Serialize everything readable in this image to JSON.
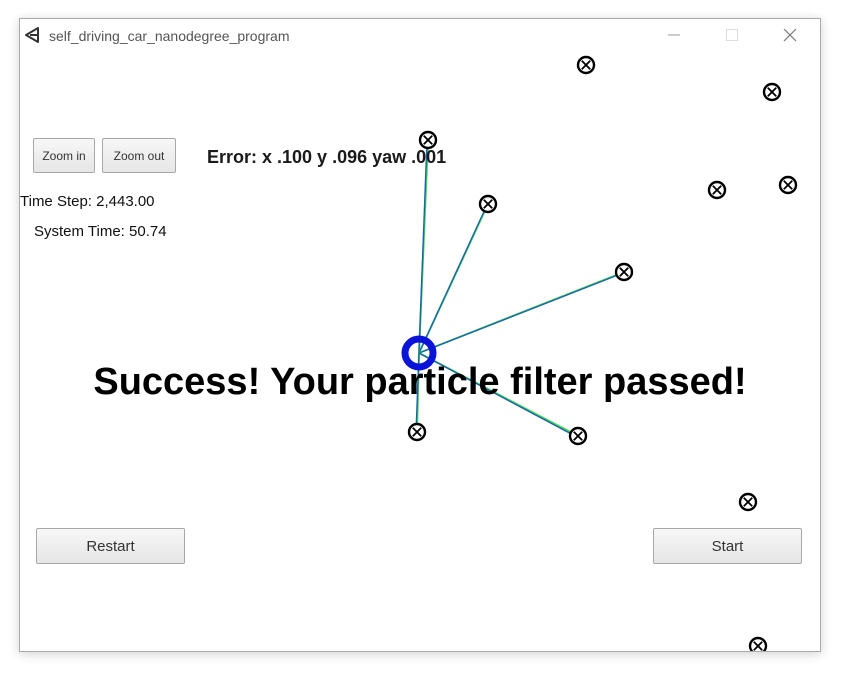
{
  "window": {
    "title": "self_driving_car_nanodegree_program"
  },
  "controls": {
    "zoom_in_label": "Zoom in",
    "zoom_out_label": "Zoom out",
    "restart_label": "Restart",
    "start_label": "Start"
  },
  "readouts": {
    "error": "Error: x .100 y .096 yaw .001",
    "time_step": "Time Step: 2,443.00",
    "system_time": "System Time: 50.74"
  },
  "status": {
    "message": "Success! Your particle filter passed!"
  },
  "colors": {
    "car": "#0a14d8",
    "observation_line": "#3ddc4a",
    "prediction_line": "#1f5fb4",
    "landmark": "#000000"
  },
  "icons": {
    "app": "unity-logo-icon",
    "minimize": "minimize-icon",
    "maximize": "maximize-icon",
    "close": "close-icon",
    "landmark": "landmark-marker-icon",
    "car": "car-marker-icon"
  }
}
